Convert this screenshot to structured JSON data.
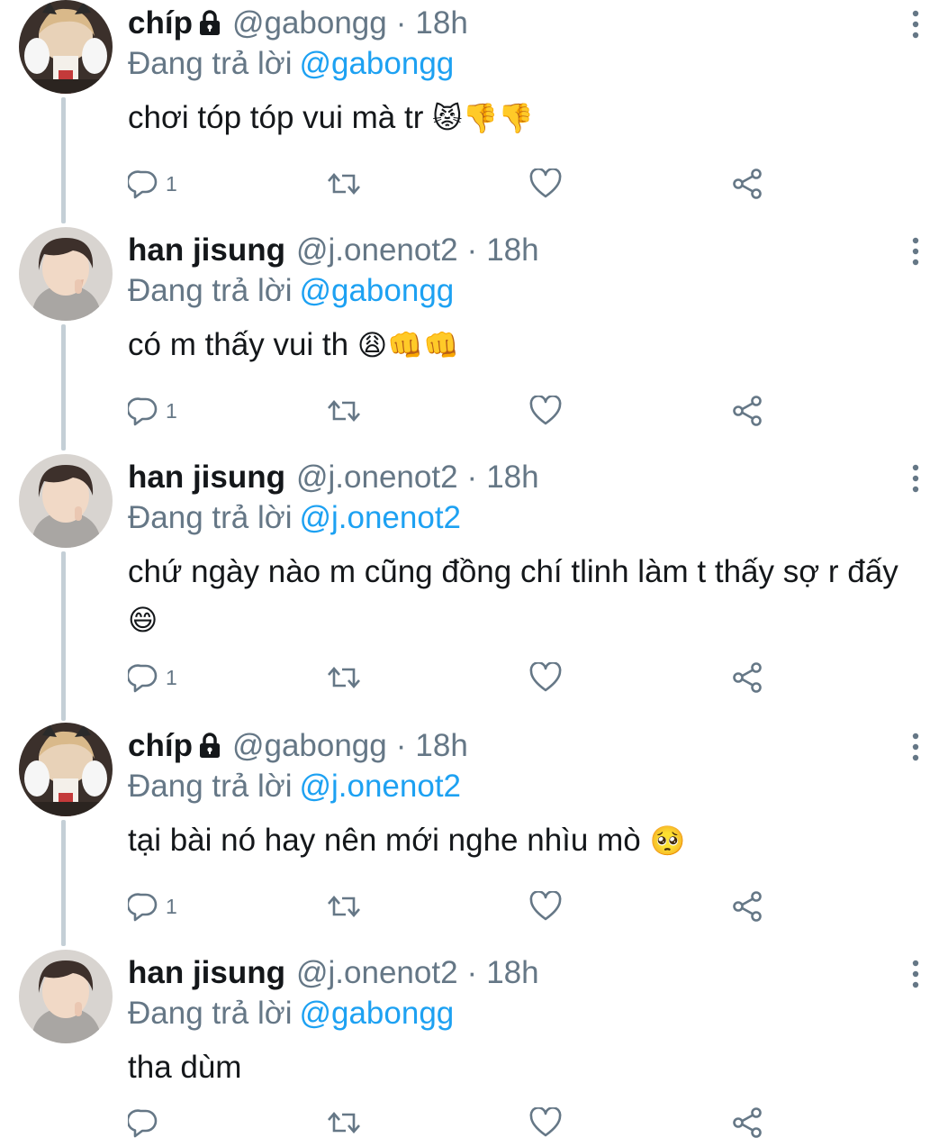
{
  "reply_prefix": "Đang trả lời",
  "tweets": [
    {
      "name": "chíp",
      "protected": true,
      "handle": "@gabongg",
      "separator": "·",
      "time": "18h",
      "reply_to": "@gabongg",
      "text": "chơi tóp tóp vui mà tr",
      "emojis": "😾👎👎",
      "reply_count": "1",
      "avatar": "avatar-chip"
    },
    {
      "name": "han jisung",
      "protected": false,
      "handle": "@j.onenot2",
      "separator": "·",
      "time": "18h",
      "reply_to": "@gabongg",
      "text": "có m thấy vui th",
      "emojis": "😩👊👊",
      "reply_count": "1",
      "avatar": "avatar-han"
    },
    {
      "name": "han jisung",
      "protected": false,
      "handle": "@j.onenot2",
      "separator": "·",
      "time": "18h",
      "reply_to": "@j.onenot2",
      "text": "chứ ngày nào m cũng đồng chí tlinh làm t thấy sợ r đấy",
      "emojis": "😄",
      "reply_count": "1",
      "avatar": "avatar-han"
    },
    {
      "name": "chíp",
      "protected": true,
      "handle": "@gabongg",
      "separator": "·",
      "time": "18h",
      "reply_to": "@j.onenot2",
      "text": "tại bài nó hay nên mới nghe nhìu mò",
      "emojis": "🥺",
      "reply_count": "1",
      "avatar": "avatar-chip"
    },
    {
      "name": "han jisung",
      "protected": false,
      "handle": "@j.onenot2",
      "separator": "·",
      "time": "18h",
      "reply_to": "@gabongg",
      "text": "tha dùm",
      "emojis": "",
      "reply_count": "",
      "avatar": "avatar-han"
    }
  ],
  "colors": {
    "link": "#1da1f2",
    "secondary": "#657786",
    "text": "#14171a",
    "thread_line": "#c4cfd6"
  },
  "icons": {
    "reply": "reply-icon",
    "retweet": "retweet-icon",
    "like": "heart-icon",
    "share": "share-icon",
    "more": "more-icon",
    "lock": "lock-icon"
  }
}
